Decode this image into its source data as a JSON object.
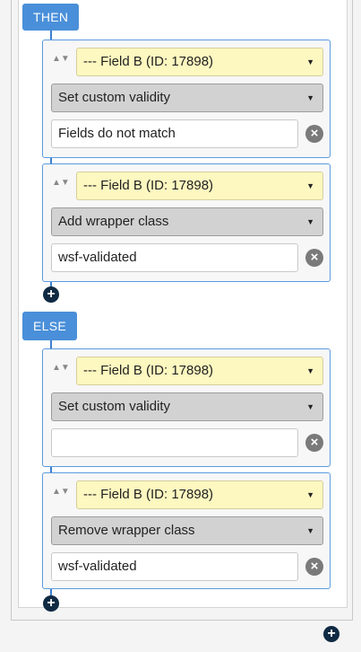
{
  "then_label": "THEN",
  "else_label": "ELSE",
  "add_symbol": "+",
  "remove_symbol": "×",
  "sort_symbol": "▲▼",
  "caret_symbol": "▼",
  "then_actions": [
    {
      "field": "--- Field B (ID: 17898)",
      "action": "Set custom validity",
      "value": "Fields do not match"
    },
    {
      "field": "--- Field B (ID: 17898)",
      "action": "Add wrapper class",
      "value": "wsf-validated"
    }
  ],
  "else_actions": [
    {
      "field": "--- Field B (ID: 17898)",
      "action": "Set custom validity",
      "value": ""
    },
    {
      "field": "--- Field B (ID: 17898)",
      "action": "Remove wrapper class",
      "value": "wsf-validated"
    }
  ],
  "colors": {
    "badge": "#4a8fd9",
    "connector": "#3c7fd0",
    "field_select": "#fdf7c0",
    "action_select": "#d2d2d2",
    "add_button": "#102a43"
  }
}
